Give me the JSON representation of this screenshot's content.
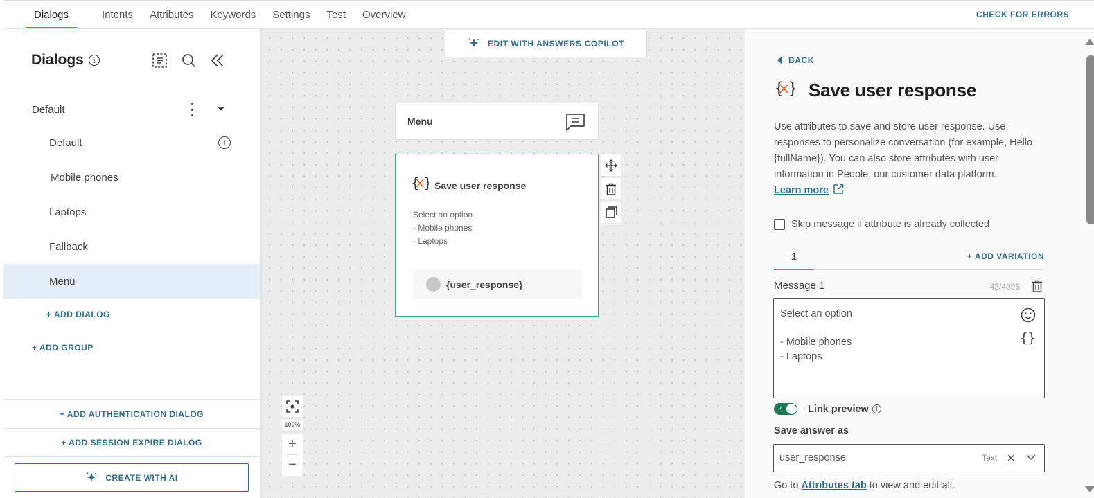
{
  "topnav": {
    "tabs": [
      {
        "label": "Dialogs",
        "active": true
      },
      {
        "label": "Intents"
      },
      {
        "label": "Attributes"
      },
      {
        "label": "Keywords"
      },
      {
        "label": "Settings"
      },
      {
        "label": "Test"
      },
      {
        "label": "Overview"
      }
    ],
    "check_errors": "CHECK FOR ERRORS"
  },
  "sidebar": {
    "title": "Dialogs",
    "info_glyph": "i",
    "tools": [
      "list-icon",
      "search-icon",
      "collapse-icon"
    ],
    "group": {
      "label": "Default"
    },
    "dialogs": [
      {
        "label": "Default",
        "info": true
      },
      {
        "label": "Mobile phones"
      },
      {
        "label": "Laptops"
      },
      {
        "label": "Fallback"
      },
      {
        "label": "Menu",
        "active": true
      }
    ],
    "add_dialog": "+ ADD DIALOG",
    "add_group": "+ ADD GROUP",
    "add_auth_dialog": "+ ADD AUTHENTICATION DIALOG",
    "add_session_dialog": "+ ADD SESSION EXPIRE DIALOG",
    "create_ai": "CREATE WITH AI"
  },
  "canvas": {
    "copilot_button": "EDIT WITH ANSWERS COPILOT",
    "menu_node": {
      "title": "Menu"
    },
    "save_node": {
      "title": "Save user response",
      "body_lines": [
        "Select an option",
        "- Mobile phones",
        "- Laptops"
      ],
      "variable": "{user_response}"
    },
    "zoom_level": "100%",
    "zoom_in": "+",
    "zoom_out": "−"
  },
  "panel": {
    "back": "BACK",
    "title": "Save user response",
    "description": "Use attributes to save and store user response. Use responses to personalize conversation (for example, Hello {fullName}). You can also store attributes with user information in People, our customer data platform.",
    "learn_more": "Learn more",
    "skip_label": "Skip message if attribute is already collected",
    "skip_checked": false,
    "variation_tab": "1",
    "add_variation": "+ ADD VARIATION",
    "message_label": "Message 1",
    "char_count": "43/4096",
    "message_text": "Select an option\n\n- Mobile phones\n- Laptops",
    "braces_glyph": "{}",
    "link_preview_label": "Link preview",
    "link_preview_on": true,
    "save_answer_label": "Save answer as",
    "save_answer_value": "user_response",
    "save_answer_type": "Text",
    "clear_glyph": "✕",
    "goto_prefix": "Go to ",
    "goto_link": "Attributes tab",
    "goto_suffix": " to view and edit all."
  },
  "colors": {
    "accent": "#2f6f8c",
    "active_tab_underline": "#f05a24",
    "node_border": "#3aa88e",
    "toggle_on": "#1f7a5a",
    "selected_row": "#e4eef7"
  }
}
